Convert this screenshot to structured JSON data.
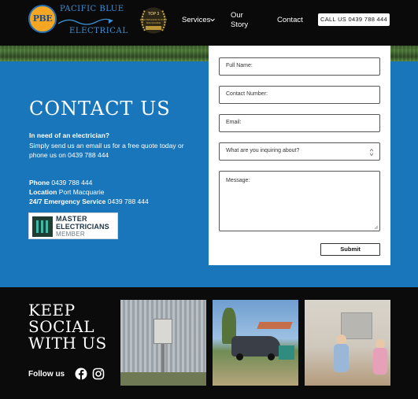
{
  "header": {
    "logo": {
      "initials": "PBE",
      "line1": "PACIFIC BLUE",
      "line2": "ELECTRICAL"
    },
    "award": {
      "top": "TOP 3",
      "text": "ELECTRICIANS IN PORT MACQUARIE"
    },
    "nav": [
      {
        "label": "Services",
        "has_dropdown": true
      },
      {
        "label": "Our Story"
      },
      {
        "label": "Contact"
      }
    ],
    "call_button": "CALL US 0439 788 444"
  },
  "contact": {
    "title": "CONTACT US",
    "intro_heading": "In need of an electrician?",
    "intro_text": "Simply send us an email us for a free quote today or phone us on 0439 788 444",
    "phone_label": "Phone",
    "phone_value": "0439 788 444",
    "location_label": "Location",
    "location_value": "Port Macquarie",
    "emergency_label": "24/7 Emergency Service",
    "emergency_value": "0439 788 444",
    "badge": {
      "line1": "MASTER",
      "line2": "ELECTRICIANS",
      "line3": "MEMBER"
    }
  },
  "form": {
    "full_name": "Full Name:",
    "contact_number": "Contact Number:",
    "email": "Email:",
    "inquiry": "What are you inquiring about?",
    "message": "Message:",
    "submit": "Submit"
  },
  "social": {
    "heading": "KEEP SOCIAL WITH US",
    "follow": "Follow us",
    "icons": [
      "facebook-icon",
      "instagram-icon"
    ]
  },
  "colors": {
    "brand_blue": "#1a76ba",
    "dark": "#0b0b0b",
    "logo_orange": "#f5a623"
  }
}
